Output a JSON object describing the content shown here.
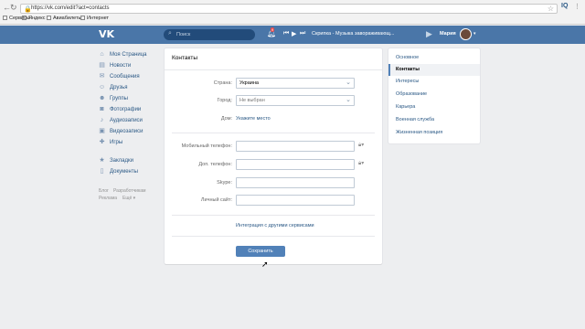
{
  "browser": {
    "url": "https://vk.com/edit?act=contacts",
    "bookmarks": [
      "Сервисы",
      "Яндекс",
      "Авиабилеты",
      "Интернет"
    ]
  },
  "header": {
    "logo": "VK",
    "search_placeholder": "Поиск",
    "notif_count": "9",
    "track": "Скрипка - Музыка завораживающ...",
    "user_name": "Мария"
  },
  "left_menu": {
    "items": [
      "Моя Страница",
      "Новости",
      "Сообщения",
      "Друзья",
      "Группы",
      "Фотографии",
      "Аудиозаписи",
      "Видеозаписи",
      "Игры"
    ],
    "items2": [
      "Закладки",
      "Документы"
    ],
    "footer": [
      "Блог",
      "Разработчикам",
      "Реклама",
      "Ещё"
    ]
  },
  "form": {
    "title": "Контакты",
    "country_label": "Страна:",
    "country_value": "Украина",
    "city_label": "Город:",
    "city_value": "Не выбран",
    "home_label": "Дом:",
    "home_link": "Укажите место",
    "mobile_label": "Мобильный телефон:",
    "home_phone_label": "Доп. телефон:",
    "skype_label": "Skype:",
    "site_label": "Личный сайт:",
    "integration_link": "Интеграция с другими сервисами",
    "save_label": "Сохранить"
  },
  "right_menu": {
    "items": [
      "Основное",
      "Контакты",
      "Интересы",
      "Образование",
      "Карьера",
      "Военная служба",
      "Жизненная позиция"
    ],
    "active_index": 1
  },
  "colors": {
    "header": "#4a76a8",
    "link": "#2a5885",
    "button": "#5181b8"
  }
}
